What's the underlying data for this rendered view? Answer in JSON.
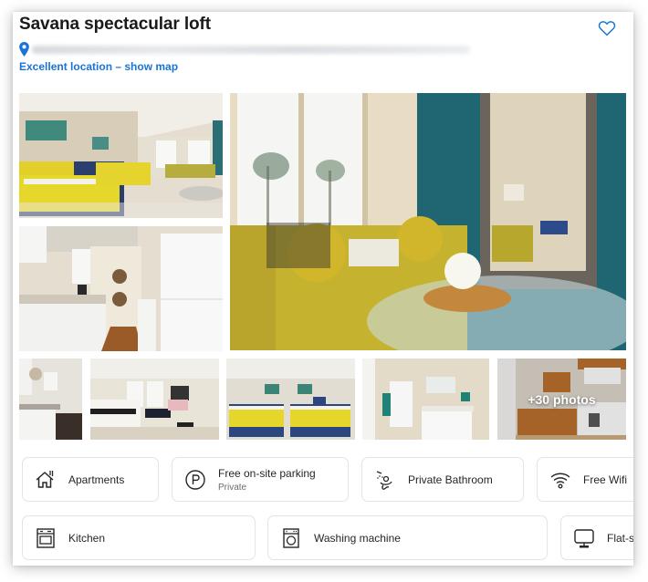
{
  "listing": {
    "title": "Savana spectacular loft",
    "address_blurred": true,
    "map_link": "Excellent location – show map",
    "favorite_icon": "heart-outline-icon",
    "accent_color": "#1a73d9"
  },
  "gallery": {
    "photos": [
      {
        "subject": "bedroom with two yellow beds"
      },
      {
        "subject": "galley kitchen"
      },
      {
        "subject": "living room with yellow sofa and mirror"
      },
      {
        "subject": "kitchenette"
      },
      {
        "subject": "bedroom and lounge"
      },
      {
        "subject": "bedroom with two beds"
      },
      {
        "subject": "bathroom"
      },
      {
        "subject": "kitchen"
      }
    ],
    "more_label": "+30 photos"
  },
  "facilities": [
    {
      "label": "Apartments",
      "sublabel": "",
      "icon": "house-icon"
    },
    {
      "label": "Free on-site parking",
      "sublabel": "Private",
      "icon": "parking-icon"
    },
    {
      "label": "Private Bathroom",
      "sublabel": "",
      "icon": "shower-icon"
    },
    {
      "label": "Free Wifi",
      "sublabel": "",
      "icon": "wifi-icon"
    },
    {
      "label": "Kitchen",
      "sublabel": "",
      "icon": "oven-icon"
    },
    {
      "label": "Washing machine",
      "sublabel": "",
      "icon": "washing-machine-icon"
    },
    {
      "label": "Flat-s",
      "sublabel": "",
      "icon": "monitor-icon"
    }
  ]
}
